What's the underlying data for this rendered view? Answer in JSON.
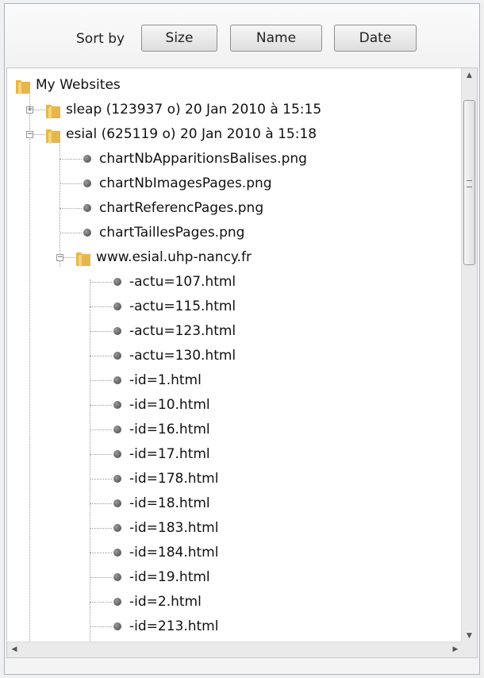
{
  "toolbar": {
    "sort_label": "Sort by",
    "buttons": [
      "Size",
      "Name",
      "Date"
    ]
  },
  "tree": {
    "root": "My Websites",
    "nodes": [
      {
        "label": "sleap (123937 o) 20 Jan 2010 à 15:15",
        "type": "folder",
        "state": "collapsed"
      },
      {
        "label": "esial (625119 o) 20 Jan 2010 à 15:18",
        "type": "folder",
        "state": "expanded"
      },
      {
        "label": "chartNbApparitionsBalises.png",
        "type": "file"
      },
      {
        "label": "chartNbImagesPages.png",
        "type": "file"
      },
      {
        "label": "chartReferencPages.png",
        "type": "file"
      },
      {
        "label": "chartTaillesPages.png",
        "type": "file"
      },
      {
        "label": "www.esial.uhp-nancy.fr",
        "type": "folder",
        "state": "expanded"
      },
      {
        "label": "-actu=107.html",
        "type": "file"
      },
      {
        "label": "-actu=115.html",
        "type": "file"
      },
      {
        "label": "-actu=123.html",
        "type": "file"
      },
      {
        "label": "-actu=130.html",
        "type": "file"
      },
      {
        "label": "-id=1.html",
        "type": "file"
      },
      {
        "label": "-id=10.html",
        "type": "file"
      },
      {
        "label": "-id=16.html",
        "type": "file"
      },
      {
        "label": "-id=17.html",
        "type": "file"
      },
      {
        "label": "-id=178.html",
        "type": "file"
      },
      {
        "label": "-id=18.html",
        "type": "file"
      },
      {
        "label": "-id=183.html",
        "type": "file"
      },
      {
        "label": "-id=184.html",
        "type": "file"
      },
      {
        "label": "-id=19.html",
        "type": "file"
      },
      {
        "label": "-id=2.html",
        "type": "file"
      },
      {
        "label": "-id=213.html",
        "type": "file"
      }
    ]
  },
  "icons": {
    "expand": "plus-box-icon",
    "collapse": "minus-box-icon",
    "folder": "folder-icon",
    "file": "file-bullet-icon"
  },
  "colors": {
    "folder": "#f2c94c",
    "selection_border": "#a9b4c2"
  }
}
